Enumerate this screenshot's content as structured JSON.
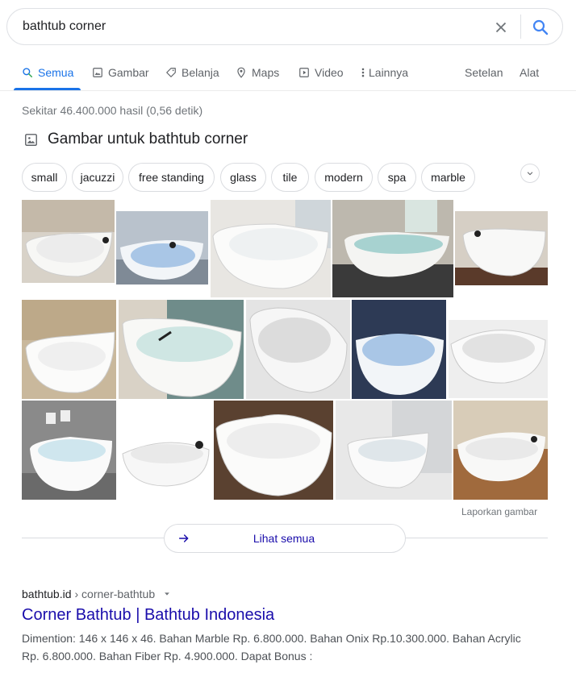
{
  "search": {
    "query": "bathtub corner"
  },
  "tabs": [
    {
      "label": "Semua",
      "icon": "search-icon"
    },
    {
      "label": "Gambar",
      "icon": "image-icon"
    },
    {
      "label": "Belanja",
      "icon": "tag-icon"
    },
    {
      "label": "Maps",
      "icon": "map-pin-icon"
    },
    {
      "label": "Video",
      "icon": "play-icon"
    },
    {
      "label": "Lainnya",
      "icon": "more-vert-icon"
    }
  ],
  "tools": {
    "settings": "Setelan",
    "tools": "Alat"
  },
  "stats": "Sekitar 46.400.000 hasil (0,56 detik)",
  "images_section": {
    "title": "Gambar untuk bathtub corner",
    "chips": [
      "small",
      "jacuzzi",
      "free standing",
      "glass",
      "tile",
      "modern",
      "spa",
      "marble"
    ],
    "report": "Laporkan gambar",
    "see_all": "Lihat semua"
  },
  "result": {
    "domain": "bathtub.id",
    "path": "› corner-bathtub",
    "title": "Corner Bathtub | Bathtub Indonesia",
    "snippet": "Dimention: 146 x 146 x 46. Bahan Marble Rp. 6.800.000. Bahan Onix Rp.10.300.000. Bahan Acrylic Rp. 6.800.000. Bahan Fiber Rp. 4.900.000. Dapat Bonus :"
  },
  "colors": {
    "accent": "#1a73e8",
    "link": "#1a0dab",
    "muted": "#70757a"
  }
}
